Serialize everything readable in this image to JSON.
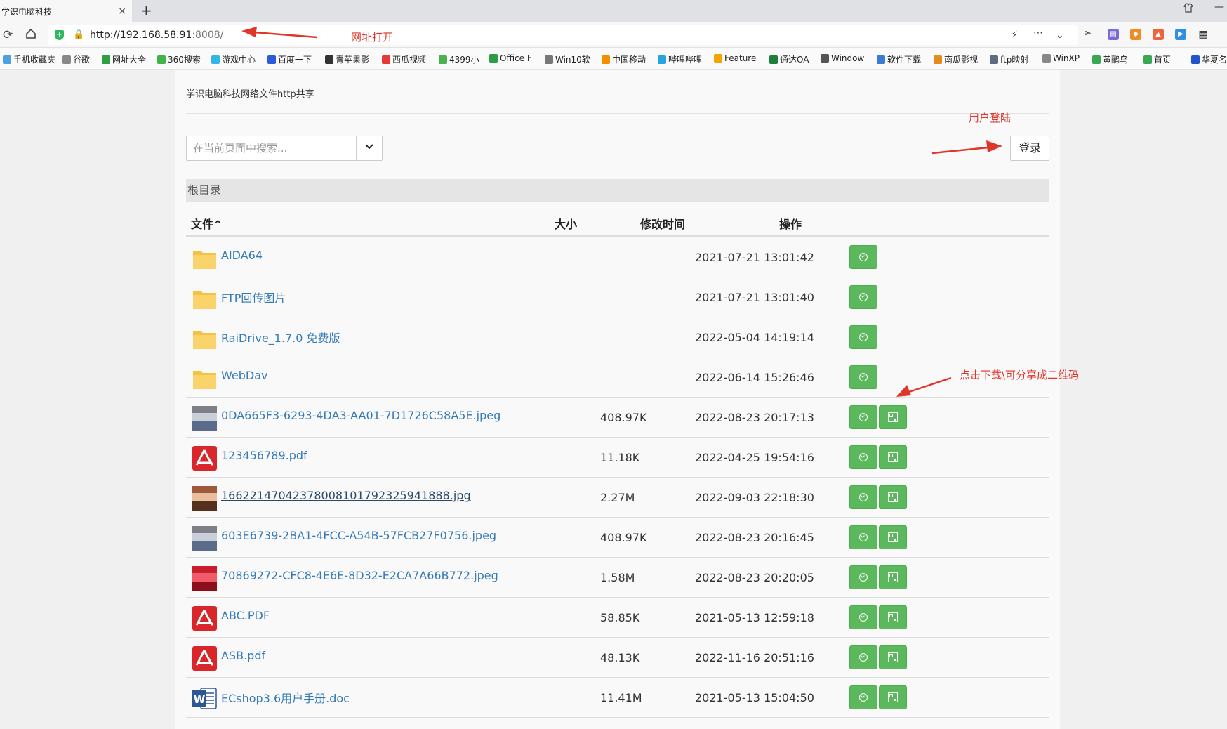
{
  "browser": {
    "tab_title": "学识电脑科技",
    "tab_close": "×",
    "new_tab": "+",
    "url_host": "http://192.168.58.91",
    "url_port": ":8008/",
    "bookmarks": [
      {
        "label": "手机收藏夹",
        "color": "#4aa3df"
      },
      {
        "label": "谷歌",
        "color": "#888888"
      },
      {
        "label": "网址大全",
        "color": "#2ea043"
      },
      {
        "label": "360搜索",
        "color": "#41b34a"
      },
      {
        "label": "游戏中心",
        "color": "#33b5e5"
      },
      {
        "label": "百度一下",
        "color": "#2d5bd6"
      },
      {
        "label": "青苹果影",
        "color": "#333333"
      },
      {
        "label": "西瓜视频",
        "color": "#e53935"
      },
      {
        "label": "4399小",
        "color": "#4caf50"
      },
      {
        "label": "Office F",
        "color": "#2e9b46"
      },
      {
        "label": "Win10软",
        "color": "#777777"
      },
      {
        "label": "中国移动",
        "color": "#f29100"
      },
      {
        "label": "哔哩哔哩",
        "color": "#2aa4e0"
      },
      {
        "label": "Feature",
        "color": "#f2a500"
      },
      {
        "label": "通达OA",
        "color": "#1d7f3c"
      },
      {
        "label": "Window",
        "color": "#555555"
      },
      {
        "label": "软件下载",
        "color": "#3a7bd5"
      },
      {
        "label": "南瓜影视",
        "color": "#e58a1f"
      },
      {
        "label": "ftp映射",
        "color": "#5d6d7e"
      },
      {
        "label": "WinXP",
        "color": "#888888"
      },
      {
        "label": "黄鹂鸟",
        "color": "#3aa757"
      },
      {
        "label": "首页 -",
        "color": "#3aa757"
      },
      {
        "label": "华夏名",
        "color": "#2255cc"
      }
    ]
  },
  "page": {
    "site_title": "学识电脑科技网络文件http共享",
    "search_placeholder": "在当前页面中搜索...",
    "login_label": "登录",
    "breadcrumb": "根目录",
    "columns": {
      "name": "文件",
      "sort_indicator": "^",
      "size": "大小",
      "modified": "修改时间",
      "actions": "操作"
    },
    "rows": [
      {
        "icon": "folder-icon",
        "name": "AIDA64",
        "size": "",
        "time": "2021-07-21 13:01:42",
        "qr": false
      },
      {
        "icon": "folder-icon",
        "name": "FTP回传图片",
        "size": "",
        "time": "2021-07-21 13:01:40",
        "qr": false
      },
      {
        "icon": "folder-icon",
        "name": "RaiDrive_1.7.0 免费版",
        "size": "",
        "time": "2022-05-04 14:19:14",
        "qr": false
      },
      {
        "icon": "folder-icon",
        "name": "WebDav",
        "size": "",
        "time": "2022-06-14 15:26:46",
        "qr": false
      },
      {
        "icon": "image-thumbnail-icon",
        "name": "0DA665F3-6293-4DA3-AA01-7D1726C58A5E.jpeg",
        "size": "408.97K",
        "time": "2022-08-23 20:17:13",
        "qr": true
      },
      {
        "icon": "pdf-icon",
        "name": "123456789.pdf",
        "size": "11.18K",
        "time": "2022-04-25 19:54:16",
        "qr": true
      },
      {
        "icon": "image-thumbnail-icon",
        "name": "16622147042378008101792325941888.jpg",
        "size": "2.27M",
        "time": "2022-09-03 22:18:30",
        "qr": true
      },
      {
        "icon": "image-thumbnail-icon",
        "name": "603E6739-2BA1-4FCC-A54B-57FCB27F0756.jpeg",
        "size": "408.97K",
        "time": "2022-08-23 20:16:45",
        "qr": true
      },
      {
        "icon": "image-thumbnail-icon",
        "name": "70869272-CFC8-4E6E-8D32-E2CA7A66B772.jpeg",
        "size": "1.58M",
        "time": "2022-08-23 20:20:05",
        "qr": true
      },
      {
        "icon": "pdf-icon",
        "name": "ABC.PDF",
        "size": "58.85K",
        "time": "2021-05-13 12:59:18",
        "qr": true
      },
      {
        "icon": "pdf-icon",
        "name": "ASB.pdf",
        "size": "48.13K",
        "time": "2022-11-16 20:51:16",
        "qr": true
      },
      {
        "icon": "word-icon",
        "name": "ECshop3.6用户手册.doc",
        "size": "11.41M",
        "time": "2021-05-13 15:04:50",
        "qr": true
      }
    ]
  },
  "annotations": {
    "url_note": "网址打开",
    "login_note": "用户登陆",
    "download_note": "点击下载\\可分享成二维码"
  },
  "colors": {
    "accent_green": "#5cb85c",
    "link_blue": "#337ab7",
    "annotation_red": "#e0352b"
  }
}
